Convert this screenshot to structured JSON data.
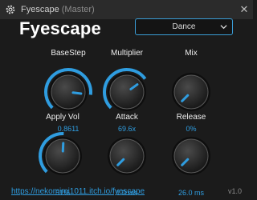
{
  "window": {
    "title": "Fyescape",
    "title_suffix": "(Master)",
    "close_glyph": "✕"
  },
  "header": {
    "plugin_name": "Fyescape",
    "preset": {
      "selected": "Dance"
    }
  },
  "colors": {
    "accent": "#2f9de0",
    "background": "#1b1b1b",
    "titlebar": "#2b2b2b"
  },
  "knobs": [
    {
      "id": "basestep",
      "label": "BaseStep",
      "value": "0.8611",
      "level": 0.86
    },
    {
      "id": "multiplier",
      "label": "Multiplier",
      "value": "69.6x",
      "level": 0.7
    },
    {
      "id": "mix",
      "label": "Mix",
      "value": "0%",
      "level": 0.0
    },
    {
      "id": "applyvol",
      "label": "Apply Vol",
      "value": "51%",
      "level": 0.51
    },
    {
      "id": "attack",
      "label": "Attack",
      "value": "1.0 ms",
      "level": 0.0
    },
    {
      "id": "release",
      "label": "Release",
      "value": "26.0 ms",
      "level": 0.0
    }
  ],
  "footer": {
    "link": "https://nekomimi1011.itch.io/fyescape",
    "version": "v1.0"
  }
}
